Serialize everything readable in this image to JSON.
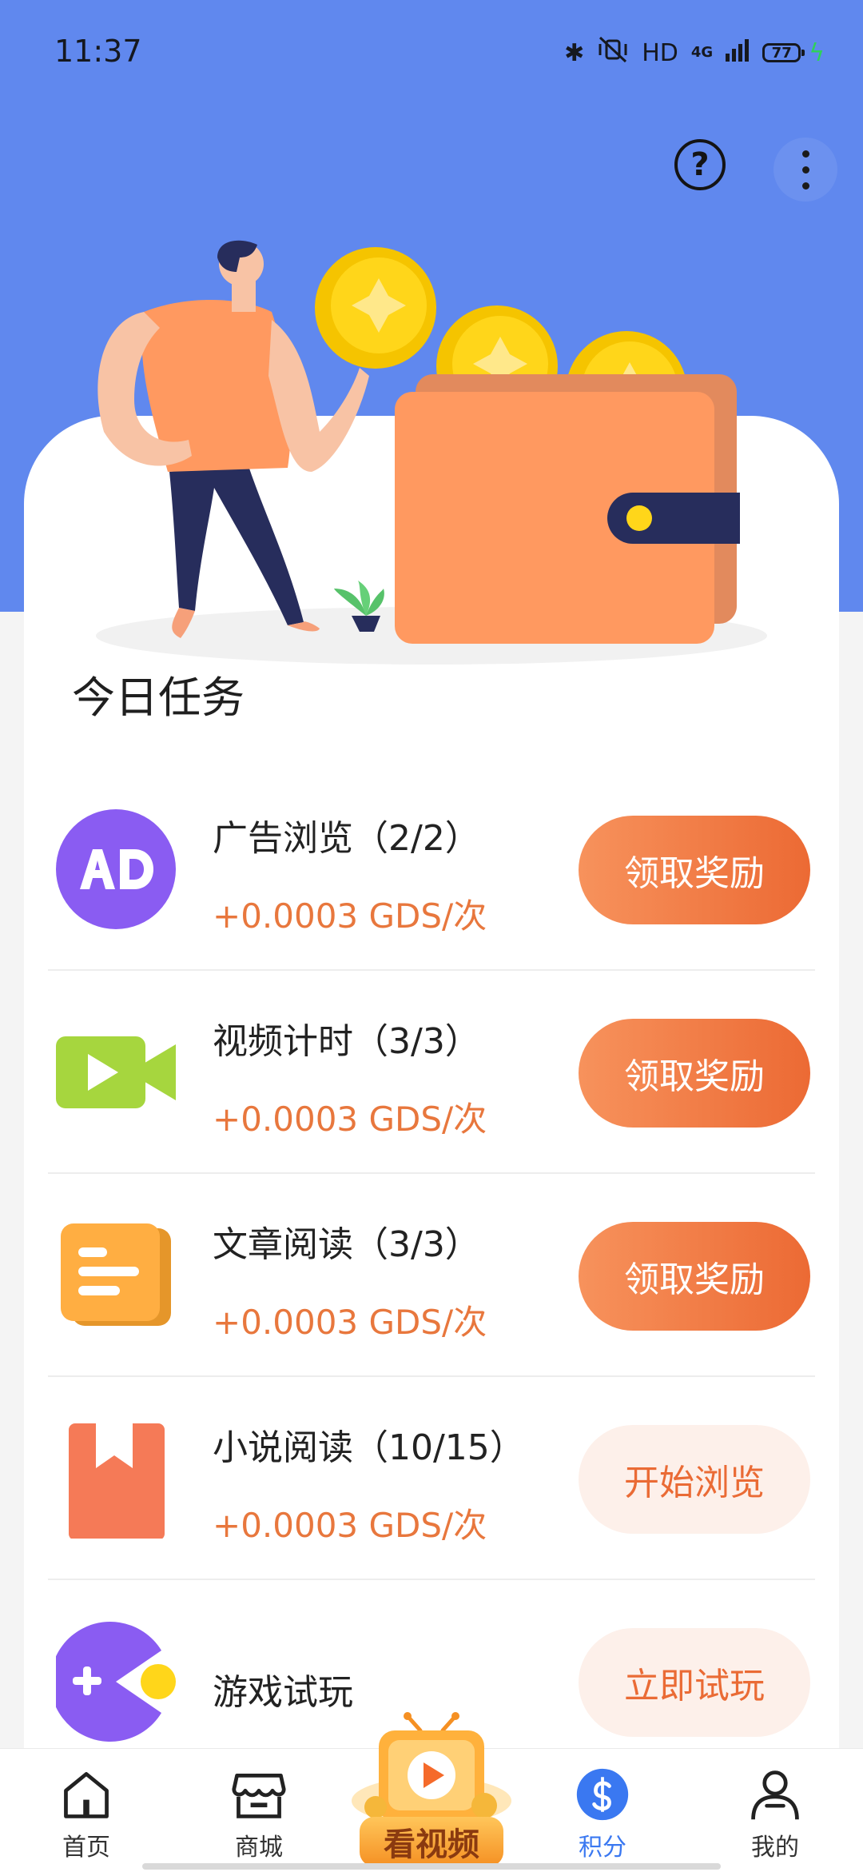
{
  "status_bar": {
    "time": "11:37",
    "hd": "HD",
    "network": "4G",
    "battery": "77"
  },
  "header": {
    "help_icon": "help-circle-icon",
    "more_icon": "more-vertical-icon"
  },
  "section_title": "今日任务",
  "tasks": [
    {
      "icon": "ad-icon",
      "title": "广告浏览（2/2）",
      "reward": "+0.0003 GDS/次",
      "button": "领取奖励"
    },
    {
      "icon": "video-camera-icon",
      "title": "视频计时（3/3）",
      "reward": "+0.0003 GDS/次",
      "button": "领取奖励"
    },
    {
      "icon": "article-icon",
      "title": "文章阅读（3/3）",
      "reward": "+0.0003 GDS/次",
      "button": "领取奖励"
    },
    {
      "icon": "bookmark-book-icon",
      "title": "小说阅读（10/15）",
      "reward": "+0.0003 GDS/次",
      "button": "开始浏览"
    },
    {
      "icon": "game-pacman-icon",
      "title": "游戏试玩",
      "reward": "",
      "button": "立即试玩"
    }
  ],
  "bottom_nav": {
    "items": [
      {
        "label": "首页",
        "icon": "home-icon"
      },
      {
        "label": "商城",
        "icon": "store-icon"
      },
      {
        "label": "看视频",
        "icon": "play-video-icon"
      },
      {
        "label": "积分",
        "icon": "points-coin-icon",
        "active": true
      },
      {
        "label": "我的",
        "icon": "user-icon"
      }
    ]
  },
  "colors": {
    "hero_blue": "#6088ee",
    "accent_orange": "#ec6a34",
    "active_blue": "#3a78f1"
  }
}
